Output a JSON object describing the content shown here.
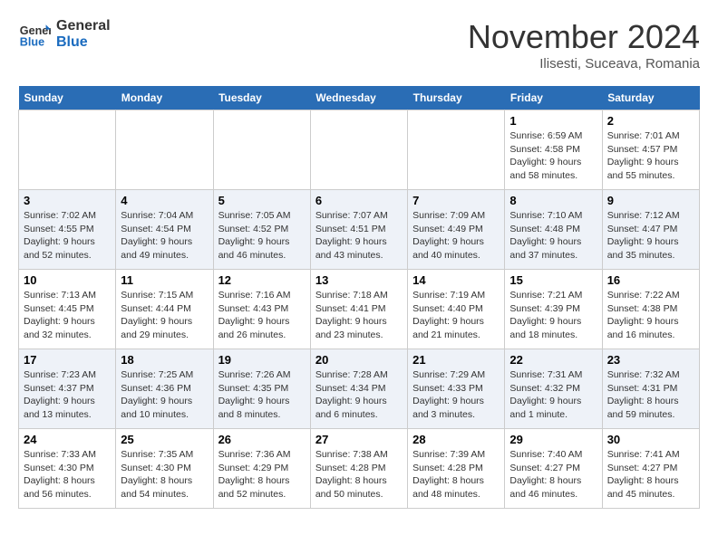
{
  "header": {
    "logo_line1": "General",
    "logo_line2": "Blue",
    "title": "November 2024",
    "subtitle": "Ilisesti, Suceava, Romania"
  },
  "weekdays": [
    "Sunday",
    "Monday",
    "Tuesday",
    "Wednesday",
    "Thursday",
    "Friday",
    "Saturday"
  ],
  "weeks": [
    [
      {
        "day": "",
        "info": ""
      },
      {
        "day": "",
        "info": ""
      },
      {
        "day": "",
        "info": ""
      },
      {
        "day": "",
        "info": ""
      },
      {
        "day": "",
        "info": ""
      },
      {
        "day": "1",
        "info": "Sunrise: 6:59 AM\nSunset: 4:58 PM\nDaylight: 9 hours and 58 minutes."
      },
      {
        "day": "2",
        "info": "Sunrise: 7:01 AM\nSunset: 4:57 PM\nDaylight: 9 hours and 55 minutes."
      }
    ],
    [
      {
        "day": "3",
        "info": "Sunrise: 7:02 AM\nSunset: 4:55 PM\nDaylight: 9 hours and 52 minutes."
      },
      {
        "day": "4",
        "info": "Sunrise: 7:04 AM\nSunset: 4:54 PM\nDaylight: 9 hours and 49 minutes."
      },
      {
        "day": "5",
        "info": "Sunrise: 7:05 AM\nSunset: 4:52 PM\nDaylight: 9 hours and 46 minutes."
      },
      {
        "day": "6",
        "info": "Sunrise: 7:07 AM\nSunset: 4:51 PM\nDaylight: 9 hours and 43 minutes."
      },
      {
        "day": "7",
        "info": "Sunrise: 7:09 AM\nSunset: 4:49 PM\nDaylight: 9 hours and 40 minutes."
      },
      {
        "day": "8",
        "info": "Sunrise: 7:10 AM\nSunset: 4:48 PM\nDaylight: 9 hours and 37 minutes."
      },
      {
        "day": "9",
        "info": "Sunrise: 7:12 AM\nSunset: 4:47 PM\nDaylight: 9 hours and 35 minutes."
      }
    ],
    [
      {
        "day": "10",
        "info": "Sunrise: 7:13 AM\nSunset: 4:45 PM\nDaylight: 9 hours and 32 minutes."
      },
      {
        "day": "11",
        "info": "Sunrise: 7:15 AM\nSunset: 4:44 PM\nDaylight: 9 hours and 29 minutes."
      },
      {
        "day": "12",
        "info": "Sunrise: 7:16 AM\nSunset: 4:43 PM\nDaylight: 9 hours and 26 minutes."
      },
      {
        "day": "13",
        "info": "Sunrise: 7:18 AM\nSunset: 4:41 PM\nDaylight: 9 hours and 23 minutes."
      },
      {
        "day": "14",
        "info": "Sunrise: 7:19 AM\nSunset: 4:40 PM\nDaylight: 9 hours and 21 minutes."
      },
      {
        "day": "15",
        "info": "Sunrise: 7:21 AM\nSunset: 4:39 PM\nDaylight: 9 hours and 18 minutes."
      },
      {
        "day": "16",
        "info": "Sunrise: 7:22 AM\nSunset: 4:38 PM\nDaylight: 9 hours and 16 minutes."
      }
    ],
    [
      {
        "day": "17",
        "info": "Sunrise: 7:23 AM\nSunset: 4:37 PM\nDaylight: 9 hours and 13 minutes."
      },
      {
        "day": "18",
        "info": "Sunrise: 7:25 AM\nSunset: 4:36 PM\nDaylight: 9 hours and 10 minutes."
      },
      {
        "day": "19",
        "info": "Sunrise: 7:26 AM\nSunset: 4:35 PM\nDaylight: 9 hours and 8 minutes."
      },
      {
        "day": "20",
        "info": "Sunrise: 7:28 AM\nSunset: 4:34 PM\nDaylight: 9 hours and 6 minutes."
      },
      {
        "day": "21",
        "info": "Sunrise: 7:29 AM\nSunset: 4:33 PM\nDaylight: 9 hours and 3 minutes."
      },
      {
        "day": "22",
        "info": "Sunrise: 7:31 AM\nSunset: 4:32 PM\nDaylight: 9 hours and 1 minute."
      },
      {
        "day": "23",
        "info": "Sunrise: 7:32 AM\nSunset: 4:31 PM\nDaylight: 8 hours and 59 minutes."
      }
    ],
    [
      {
        "day": "24",
        "info": "Sunrise: 7:33 AM\nSunset: 4:30 PM\nDaylight: 8 hours and 56 minutes."
      },
      {
        "day": "25",
        "info": "Sunrise: 7:35 AM\nSunset: 4:30 PM\nDaylight: 8 hours and 54 minutes."
      },
      {
        "day": "26",
        "info": "Sunrise: 7:36 AM\nSunset: 4:29 PM\nDaylight: 8 hours and 52 minutes."
      },
      {
        "day": "27",
        "info": "Sunrise: 7:38 AM\nSunset: 4:28 PM\nDaylight: 8 hours and 50 minutes."
      },
      {
        "day": "28",
        "info": "Sunrise: 7:39 AM\nSunset: 4:28 PM\nDaylight: 8 hours and 48 minutes."
      },
      {
        "day": "29",
        "info": "Sunrise: 7:40 AM\nSunset: 4:27 PM\nDaylight: 8 hours and 46 minutes."
      },
      {
        "day": "30",
        "info": "Sunrise: 7:41 AM\nSunset: 4:27 PM\nDaylight: 8 hours and 45 minutes."
      }
    ]
  ]
}
